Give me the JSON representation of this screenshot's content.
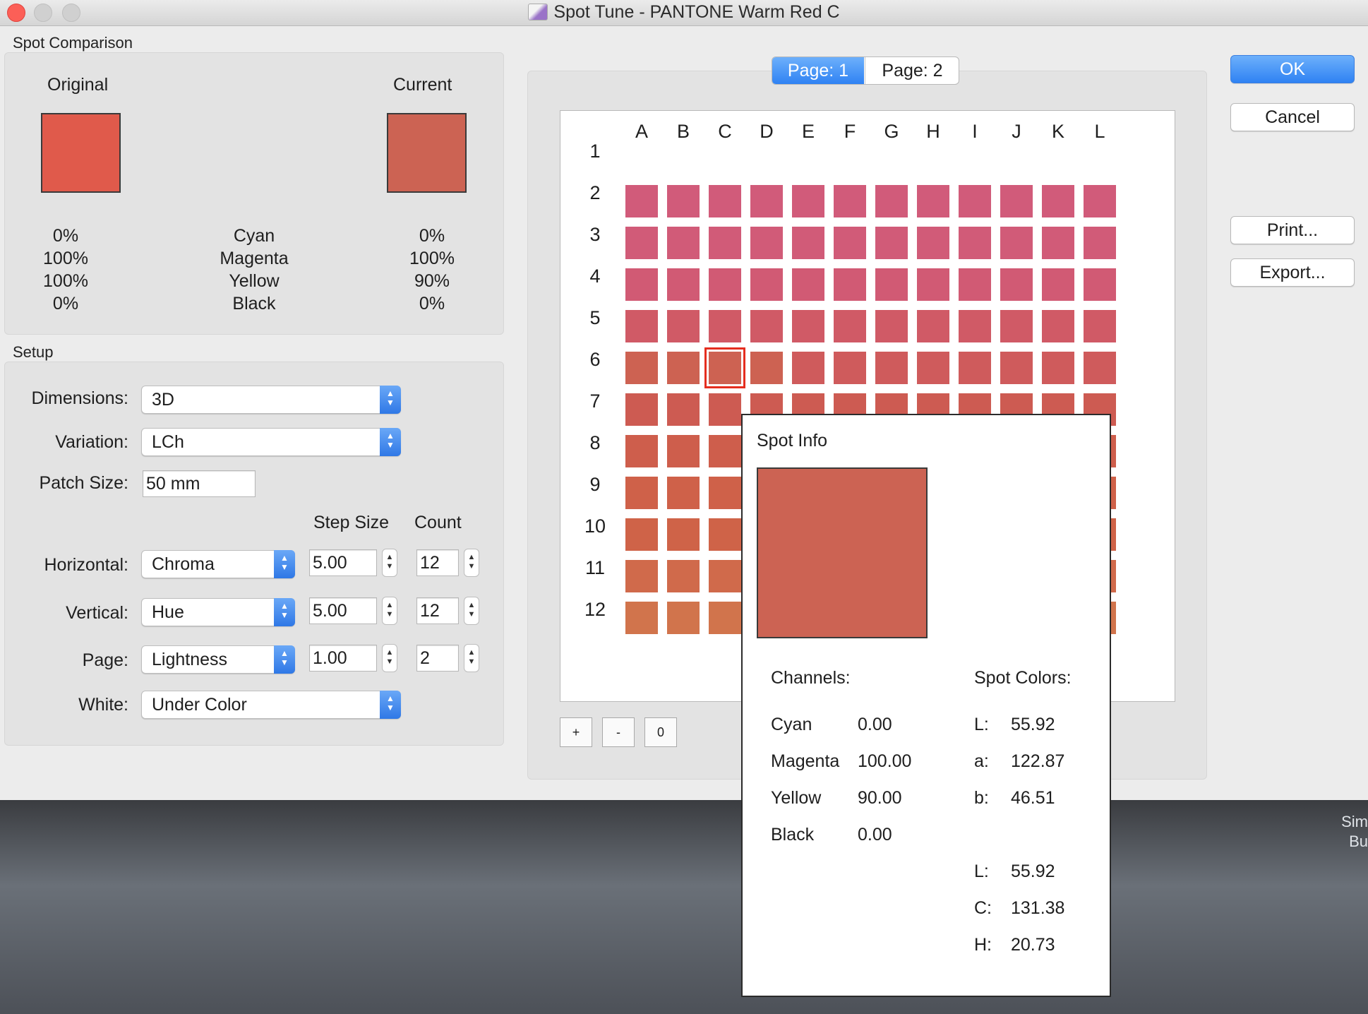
{
  "window": {
    "title": "Spot Tune - PANTONE Warm Red C"
  },
  "colors": {
    "original": "#e05a4b",
    "current": "#cc6353",
    "accent": "#2f82f3",
    "selection": "#e52e1f"
  },
  "spot_comparison": {
    "heading": "Spot Comparison",
    "original_label": "Original",
    "current_label": "Current",
    "rows": [
      {
        "orig": "0%",
        "channel": "Cyan",
        "curr": "0%"
      },
      {
        "orig": "100%",
        "channel": "Magenta",
        "curr": "100%"
      },
      {
        "orig": "100%",
        "channel": "Yellow",
        "curr": "90%"
      },
      {
        "orig": "0%",
        "channel": "Black",
        "curr": "0%"
      }
    ]
  },
  "setup": {
    "heading": "Setup",
    "dimensions_label": "Dimensions:",
    "dimensions_value": "3D",
    "variation_label": "Variation:",
    "variation_value": "LCh",
    "patch_size_label": "Patch Size:",
    "patch_size_value": "50 mm",
    "step_size_header": "Step Size",
    "count_header": "Count",
    "horizontal_label": "Horizontal:",
    "horizontal_value": "Chroma",
    "horizontal_step": "5.00",
    "horizontal_count": "12",
    "vertical_label": "Vertical:",
    "vertical_value": "Hue",
    "vertical_step": "5.00",
    "vertical_count": "12",
    "page_label": "Page:",
    "page_value": "Lightness",
    "page_step": "1.00",
    "page_count": "2",
    "white_label": "White:",
    "white_value": "Under Color"
  },
  "pages": {
    "page1": "Page: 1",
    "page2": "Page: 2",
    "selected": 1
  },
  "grid": {
    "columns": [
      "A",
      "B",
      "C",
      "D",
      "E",
      "F",
      "G",
      "H",
      "I",
      "J",
      "K",
      "L"
    ],
    "rows": [
      "1",
      "2",
      "3",
      "4",
      "5",
      "6",
      "7",
      "8",
      "9",
      "10",
      "11",
      "12"
    ],
    "row_colors": {
      "2": "#d15b7a",
      "3": "#d15b78",
      "4": "#d15a74",
      "5": "#d05a66",
      "6": "#cf5b5c",
      "7": "#cd5b52",
      "8": "#ce5e4c",
      "9": "#cf6149",
      "10": "#cf6348",
      "11": "#d06a4b",
      "12": "#d1744c"
    },
    "row6_left_color": "#cd6252",
    "selected_cell": {
      "row": "6",
      "column": "C"
    },
    "zoom_in": "+",
    "zoom_out": "-",
    "zoom_reset": "0"
  },
  "buttons": {
    "ok": "OK",
    "cancel": "Cancel",
    "print": "Print...",
    "export": "Export..."
  },
  "spot_info": {
    "heading": "Spot Info",
    "swatch_color": "#cc6353",
    "channels_heading": "Channels:",
    "spot_colors_heading": "Spot Colors:",
    "channels": [
      {
        "name": "Cyan",
        "value": "0.00"
      },
      {
        "name": "Magenta",
        "value": "100.00"
      },
      {
        "name": "Yellow",
        "value": "90.00"
      },
      {
        "name": "Black",
        "value": "0.00"
      }
    ],
    "lab": [
      {
        "key": "L:",
        "value": "55.92"
      },
      {
        "key": "a:",
        "value": "122.87"
      },
      {
        "key": "b:",
        "value": "46.51"
      }
    ],
    "lch": [
      {
        "key": "L:",
        "value": "55.92"
      },
      {
        "key": "C:",
        "value": "131.38"
      },
      {
        "key": "H:",
        "value": "20.73"
      }
    ]
  },
  "desktop": {
    "partial_text_1": "Sim",
    "partial_text_2": "Bu"
  }
}
